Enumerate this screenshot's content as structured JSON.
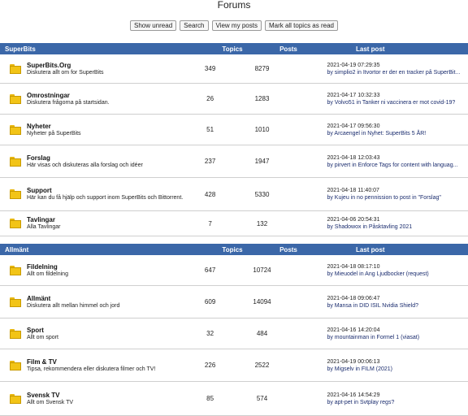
{
  "page": {
    "title": "Forums"
  },
  "actions": [
    "Show unread",
    "Search",
    "View my posts",
    "Mark all topics as read"
  ],
  "columns": {
    "topics": "Topics",
    "posts": "Posts",
    "last_post": "Last post"
  },
  "sections": [
    {
      "name": "SuperBits",
      "forums": [
        {
          "name": "SuperBits.Org",
          "desc": "Diskutera allt om for SuperBits",
          "topics": "349",
          "posts": "8279",
          "last_date": "2021-04-19 07:29:35",
          "last_by": "by simplio2 in Itvortor er der en tracker på SuperBit..."
        },
        {
          "name": "Omrostningar",
          "desc": "Diskutera frågorna på startsidan.",
          "topics": "26",
          "posts": "1283",
          "last_date": "2021-04-17 10:32:33",
          "last_by": "by Volvo51 in Tanker ni vaccinera er mot covid-19?"
        },
        {
          "name": "Nyheter",
          "desc": "Nyheter på SuperBits",
          "topics": "51",
          "posts": "1010",
          "last_date": "2021-04-17 09:56:30",
          "last_by": "by Arcaengel in Nyhet: SuperBits 5 ÅR!"
        },
        {
          "name": "Forslag",
          "desc": "Här visas och diskuteras alla forslag och idéer",
          "topics": "237",
          "posts": "1947",
          "last_date": "2021-04-18 12:03:43",
          "last_by": "by pirvert in Enforce Tags for content with languag..."
        },
        {
          "name": "Support",
          "desc": "Här kan du få hjälp och support inom SuperBits och Bittorrent.",
          "topics": "428",
          "posts": "5330",
          "last_date": "2021-04-18 11:40:07",
          "last_by": "by Kujeu in no pennission to post in \"Forslag\""
        },
        {
          "name": "Tavlingar",
          "desc": "Alla Tavlingar",
          "topics": "7",
          "posts": "132",
          "last_date": "2021-04-06 20:54:31",
          "last_by": "by Shadowox in Påsktavling 2021"
        }
      ]
    },
    {
      "name": "Allmänt",
      "forums": [
        {
          "name": "Fildelning",
          "desc": "Allt om fildelning",
          "topics": "647",
          "posts": "10724",
          "last_date": "2021-04-18 08:17:10",
          "last_by": "by Mieuodel in Ang Ljudbocker (request)"
        },
        {
          "name": "Allmänt",
          "desc": "Diskutera allt mellan himmel och jord",
          "topics": "609",
          "posts": "14094",
          "last_date": "2021-04-18 09:06:47",
          "last_by": "by Mansa in DID ISIL Nvidia Shield?"
        },
        {
          "name": "Sport",
          "desc": "Allt om sport",
          "topics": "32",
          "posts": "484",
          "last_date": "2021-04-16 14:20:04",
          "last_by": "by mountainman in Formel 1 (viasat)"
        },
        {
          "name": "Film & TV",
          "desc": "Tipsa, rekommendera eller diskutera filmer och TV!",
          "topics": "226",
          "posts": "2522",
          "last_date": "2021-04-19 00:06:13",
          "last_by": "by Migselv in FILM (2021)"
        },
        {
          "name": "Svensk TV",
          "desc": "Allt om Svensk TV",
          "topics": "85",
          "posts": "574",
          "last_date": "2021-04-16 14:54:29",
          "last_by": "by apt-pet in Svtplay regs?"
        }
      ]
    }
  ]
}
